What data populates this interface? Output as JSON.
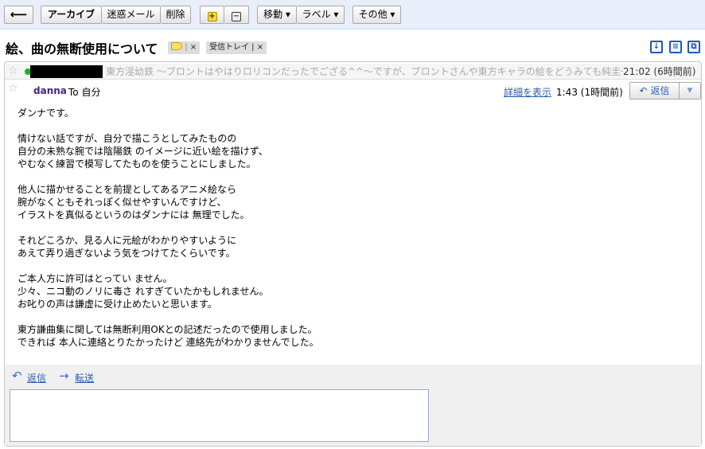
{
  "toolbar": {
    "back_icon": "back-arrow-icon",
    "archive": "アーカイブ",
    "spam": "迷惑メール",
    "delete": "削除",
    "star_plus_icon": "add-star-icon",
    "minus_icon": "remove-icon",
    "move": "移動 ▾",
    "label": "ラベル ▾",
    "more": "その他 ▾"
  },
  "thread": {
    "subject": "絵、曲の無断使用について",
    "labels": [
      {
        "text": "×",
        "color": "#fce25a"
      },
      {
        "text": "受信トレイ | ×"
      }
    ],
    "action_icons": [
      "archive-thread-icon",
      "print-icon",
      "new-window-icon"
    ]
  },
  "collapsed_message": {
    "snippet": "東方淫幼鉄 〜ブロントはやはりロリコンだったでござる^^〜ですが、ブロントさんや東方キャラの絵をどうみても純圭一氏や",
    "time": "21:02 (6時間前)"
  },
  "message": {
    "sender": "danna",
    "to": "To 自分",
    "details_link": "詳細を表示",
    "time": "1:43 (1時間前)",
    "reply_button": "返信",
    "body_paragraphs": [
      "ダンナです。",
      "情けない話ですが、自分で描こうとしてみたものの\n自分の未熟な腕では陰陽鉄 のイメージに近い絵を描けず、\nやむなく練習で模写してたものを使うことにしました。",
      "他人に描かせることを前提としてあるアニメ絵なら\n腕がなくともそれっぽく似せやすいんですけど、\nイラストを真似るというのはダンナには 無理でした。",
      "それどころか、見る人に元絵がわかりやすいように\nあえて弄り過ぎないよう気をつけてたくらいです。",
      "ご本人方に許可はとってい ません。\n少々、ニコ動のノリに毒さ れすぎていたかもしれません。\nお叱りの声は謙虚に受け止めたいと思います。",
      "東方謙曲集に関しては無断利用OKとの記述だったので使用しました。\nできれば 本人に連絡とりたかったけど 連絡先がわかりませんでした。"
    ]
  },
  "footer": {
    "reply_link": "返信",
    "forward_link": "転送"
  }
}
